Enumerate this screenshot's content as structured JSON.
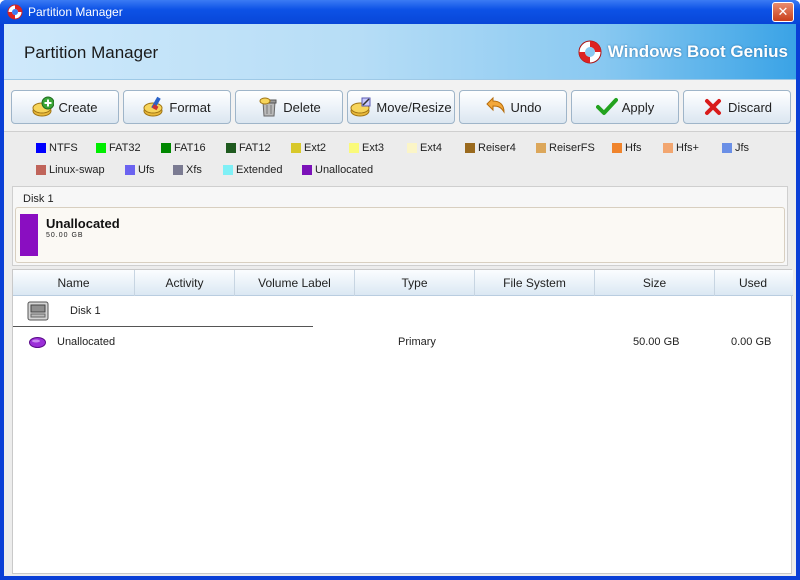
{
  "window": {
    "title": "Partition Manager",
    "close_label": "✕"
  },
  "banner": {
    "title": "Partition Manager",
    "brand": "Windows Boot Genius"
  },
  "toolbar": {
    "buttons": [
      {
        "label": "Create",
        "icon": "create-icon"
      },
      {
        "label": "Format",
        "icon": "format-icon"
      },
      {
        "label": "Delete",
        "icon": "delete-icon"
      },
      {
        "label": "Move/Resize",
        "icon": "move-resize-icon"
      },
      {
        "label": "Undo",
        "icon": "undo-icon"
      },
      {
        "label": "Apply",
        "icon": "apply-icon"
      },
      {
        "label": "Discard",
        "icon": "discard-icon"
      }
    ]
  },
  "legend": [
    {
      "label": "NTFS",
      "color": "#0000ff"
    },
    {
      "label": "FAT32",
      "color": "#00ee00"
    },
    {
      "label": "FAT16",
      "color": "#008800"
    },
    {
      "label": "FAT12",
      "color": "#1f5a1f"
    },
    {
      "label": "Ext2",
      "color": "#d8c82a"
    },
    {
      "label": "Ext3",
      "color": "#fafa7a"
    },
    {
      "label": "Ext4",
      "color": "#fbf5c7"
    },
    {
      "label": "Reiser4",
      "color": "#9a6a1e"
    },
    {
      "label": "ReiserFS",
      "color": "#dca75b"
    },
    {
      "label": "Hfs",
      "color": "#f0842c"
    },
    {
      "label": "Hfs+",
      "color": "#f2a670"
    },
    {
      "label": "Jfs",
      "color": "#6a8fe6"
    },
    {
      "label": "Linux-swap",
      "color": "#c0645a"
    },
    {
      "label": "Ufs",
      "color": "#6b63f0"
    },
    {
      "label": "Xfs",
      "color": "#7b7b92"
    },
    {
      "label": "Extended",
      "color": "#7ff0f6"
    },
    {
      "label": "Unallocated",
      "color": "#7b11b8"
    }
  ],
  "disk_panel": {
    "disk_label": "Disk 1",
    "partition_title": "Unallocated",
    "partition_size": "50.00 GB",
    "fill_color": "#8a0ec1"
  },
  "list": {
    "columns": [
      "Name",
      "Activity",
      "Volume Label",
      "Type",
      "File System",
      "Size",
      "Used"
    ],
    "disk_row": {
      "name": "Disk 1"
    },
    "partition_rows": [
      {
        "name": "Unallocated",
        "activity": "",
        "volume_label": "",
        "type": "Primary",
        "file_system": "",
        "size": "50.00 GB",
        "used": "0.00 GB"
      }
    ]
  }
}
